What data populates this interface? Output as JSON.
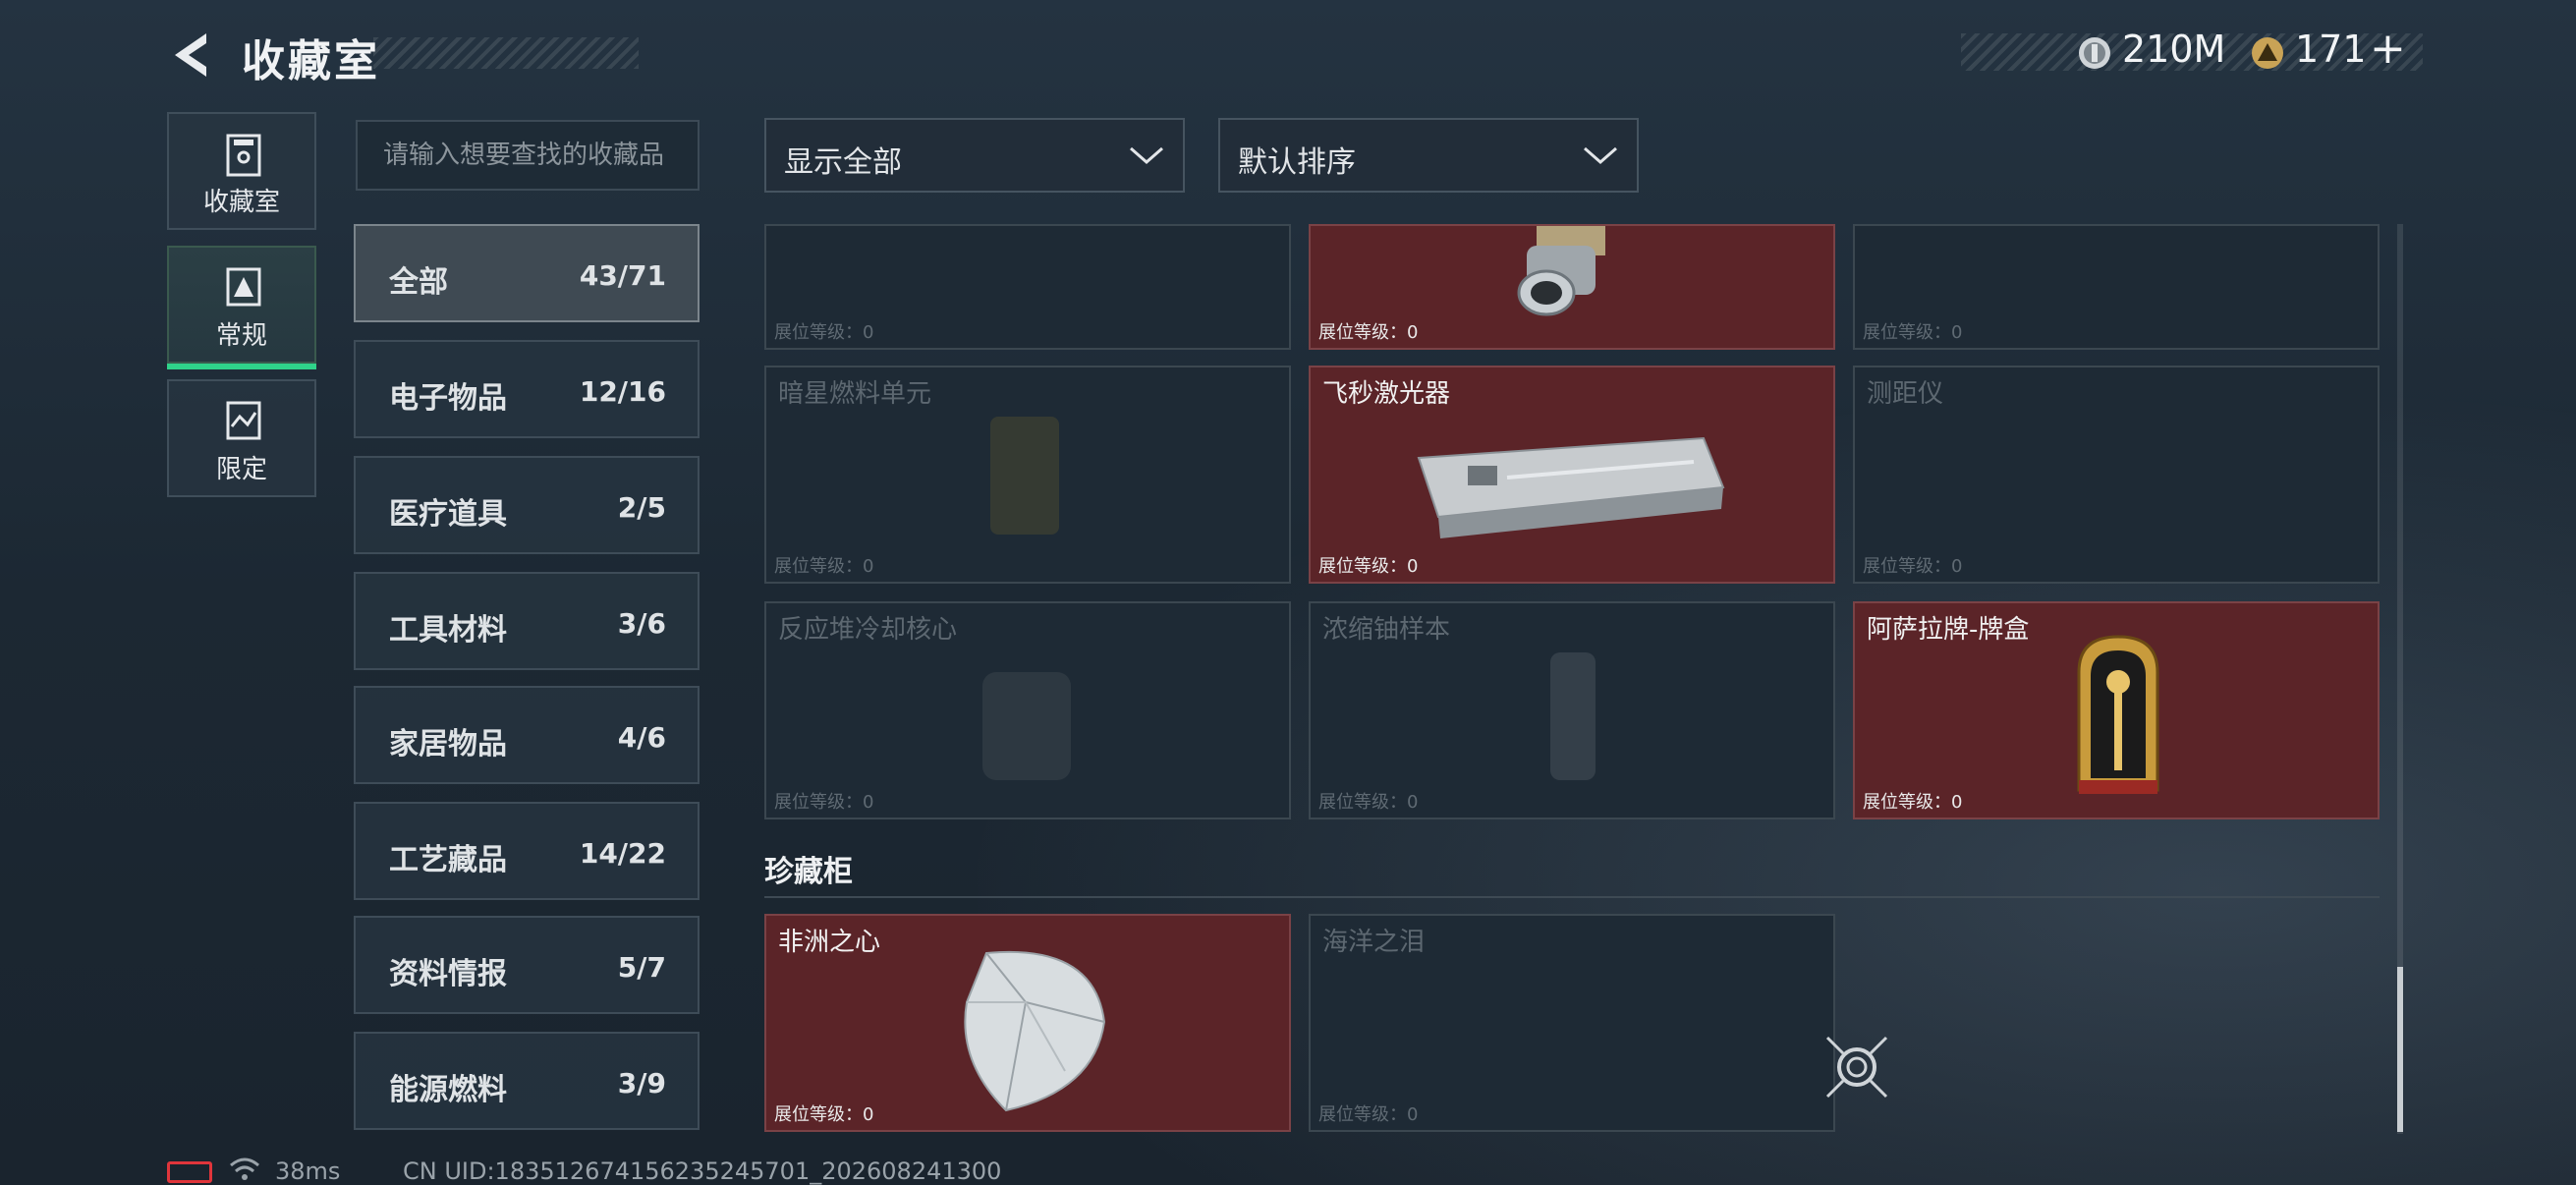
{
  "header": {
    "title": "收藏室",
    "currency1": "210M",
    "currency2": "171",
    "add_symbol": "+"
  },
  "tabs": [
    {
      "label": "收藏室",
      "icon": "collection-icon"
    },
    {
      "label": "常规",
      "icon": "regular-icon",
      "active": true
    },
    {
      "label": "限定",
      "icon": "limited-icon"
    }
  ],
  "search": {
    "placeholder": "请输入想要查找的收藏品"
  },
  "categories": [
    {
      "name": "全部",
      "count": "43/71",
      "active": true
    },
    {
      "name": "电子物品",
      "count": "12/16"
    },
    {
      "name": "医疗道具",
      "count": "2/5"
    },
    {
      "name": "工具材料",
      "count": "3/6"
    },
    {
      "name": "家居物品",
      "count": "4/6"
    },
    {
      "name": "工艺藏品",
      "count": "14/22"
    },
    {
      "name": "资料情报",
      "count": "5/7"
    },
    {
      "name": "能源燃料",
      "count": "3/9"
    }
  ],
  "filters": {
    "show": "显示全部",
    "sort": "默认排序"
  },
  "items": [
    {
      "name": "",
      "level": "展位等级：0",
      "owned": false
    },
    {
      "name": "",
      "level": "展位等级：0",
      "owned": true
    },
    {
      "name": "",
      "level": "展位等级：0",
      "owned": false
    },
    {
      "name": "暗星燃料单元",
      "level": "展位等级：0",
      "owned": false
    },
    {
      "name": "飞秒激光器",
      "level": "展位等级：0",
      "owned": true
    },
    {
      "name": "测距仪",
      "level": "展位等级：0",
      "owned": false
    },
    {
      "name": "反应堆冷却核心",
      "level": "展位等级：0",
      "owned": false
    },
    {
      "name": "浓缩铀样本",
      "level": "展位等级：0",
      "owned": false
    },
    {
      "name": "阿萨拉牌-牌盒",
      "level": "展位等级：0",
      "owned": true
    }
  ],
  "treasure": {
    "title": "珍藏柜",
    "items": [
      {
        "name": "非洲之心",
        "level": "展位等级：0",
        "owned": true
      },
      {
        "name": "海洋之泪",
        "level": "展位等级：0",
        "owned": false
      }
    ]
  },
  "footer": {
    "ping": "38ms",
    "uid": "CN UID:183512674156235245701_202608241300"
  },
  "colors": {
    "owned": "#5b2428",
    "locked": "#1e2a35",
    "accent": "#2fd38a",
    "battery": "#e0353b"
  }
}
